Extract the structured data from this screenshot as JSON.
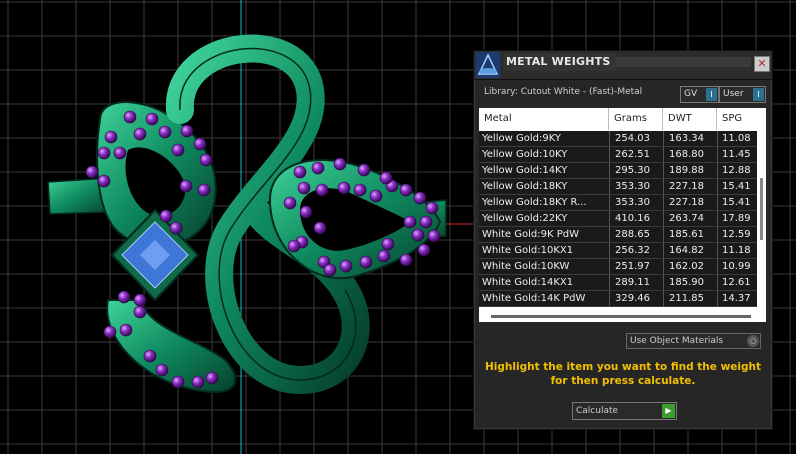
{
  "panel": {
    "title": "METAL WEIGHTS",
    "close_glyph": "✕",
    "library_label": "Library: Cutout White - (Fast)-Metal",
    "toggles": {
      "gv_label": "GV",
      "user_label": "User",
      "indicator": "I"
    },
    "table": {
      "headers": [
        "Metal",
        "Grams",
        "DWT",
        "SPG"
      ],
      "rows": [
        [
          "Yellow Gold:9KY",
          "254.03",
          "163.34",
          "11.08"
        ],
        [
          "Yellow Gold:10KY",
          "262.51",
          "168.80",
          "11.45"
        ],
        [
          "Yellow Gold:14KY",
          "295.30",
          "189.88",
          "12.88"
        ],
        [
          "Yellow Gold:18KY",
          "353.30",
          "227.18",
          "15.41"
        ],
        [
          "Yellow Gold:18KY R...",
          "353.30",
          "227.18",
          "15.41"
        ],
        [
          "Yellow Gold:22KY",
          "410.16",
          "263.74",
          "17.89"
        ],
        [
          "White Gold:9K PdW",
          "288.65",
          "185.61",
          "12.59"
        ],
        [
          "White Gold:10KX1",
          "256.32",
          "164.82",
          "11.18"
        ],
        [
          "White Gold:10KW",
          "251.97",
          "162.02",
          "10.99"
        ],
        [
          "White Gold:14KX1",
          "289.11",
          "185.90",
          "12.61"
        ],
        [
          "White Gold:14K PdW",
          "329.46",
          "211.85",
          "14.37"
        ]
      ]
    },
    "materials_select": {
      "value": "Use Object Materials",
      "knob": "○"
    },
    "hint_line1": "Highlight the item you want to find the weight",
    "hint_line2": "for then press calculate.",
    "calculate": {
      "label": "Calculate",
      "go_glyph": "▶"
    }
  },
  "colors": {
    "ring_green": "#0f8a5f",
    "gem_purple": "#8a2fc4",
    "stone_blue": "#3f77d8",
    "hint_yellow": "#f2c000",
    "toggle_blue": "#2d6f8f",
    "calc_green": "#3a9c2e"
  },
  "icons": [
    "logo-icon",
    "close-icon",
    "toggle-indicator-icon",
    "select-knob-icon",
    "play-icon"
  ]
}
